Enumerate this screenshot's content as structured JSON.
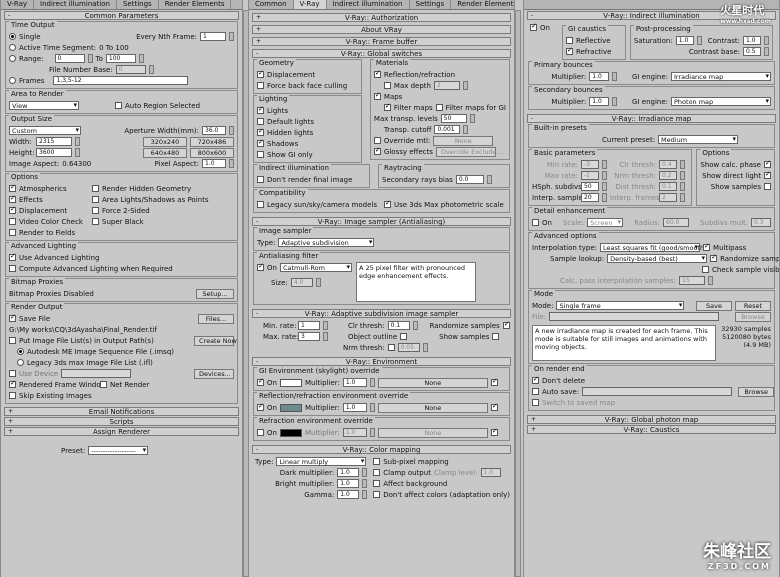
{
  "p1": {
    "tabs": [
      "V-Ray",
      "Indirect illumination",
      "Settings",
      "Render Elements"
    ],
    "common": "Common Parameters",
    "time": {
      "lg": "Time Output",
      "single": "Single",
      "nth": "Every Nth Frame:",
      "nth_v": "1",
      "active": "Active Time Segment:",
      "active_v": "0 To 100",
      "range": "Range:",
      "range_a": "0",
      "to": "To",
      "range_b": "100",
      "fnb": "File Number Base:",
      "fnb_v": "0",
      "frames": "Frames",
      "frames_v": "1,3,5-12"
    },
    "area": {
      "lg": "Area to Render",
      "view": "View",
      "auto": "Auto Region Selected"
    },
    "size": {
      "lg": "Output Size",
      "custom": "Custom",
      "aperture": "Aperture Width(mm):",
      "aperture_v": "36.0",
      "width": "Width:",
      "width_v": "2315",
      "height": "Height:",
      "height_v": "3600",
      "b1": "320x240",
      "b2": "720x486",
      "b3": "640x480",
      "b4": "800x600",
      "aspect": "Image Aspect:",
      "aspect_v": "0.64300",
      "pixel": "Pixel Aspect:",
      "pixel_v": "1.0"
    },
    "options": {
      "lg": "Options",
      "atmos": "Atmospherics",
      "hidden": "Render Hidden Geometry",
      "effects": "Effects",
      "area": "Area Lights/Shadows as Points",
      "displ": "Displacement",
      "force": "Force 2-Sided",
      "video": "Video Color Check",
      "super": "Super Black",
      "fields": "Render to Fields"
    },
    "adv": {
      "lg": "Advanced Lighting",
      "use": "Use Advanced Lighting",
      "compute": "Compute Advanced Lighting when Required"
    },
    "bitmap": {
      "lg": "Bitmap Proxies",
      "txt": "Bitmap Proxies Disabled",
      "setup": "Setup..."
    },
    "out": {
      "lg": "Render Output",
      "save": "Save File",
      "files": "Files...",
      "path": "G:\\My works\\CQ\\3dAyasha\\Final_Render.tif",
      "put": "Put Image File List(s) in Output Path(s)",
      "create": "Create Now",
      "autodesk": "Autodesk ME Image Sequence File (.imsq)",
      "legacy": "Legacy 3ds max Image File List (.ifl)",
      "device": "Use Device",
      "devices": "Devices...",
      "frame": "Rendered Frame Window",
      "net": "Net Render",
      "skip": "Skip Existing Images"
    },
    "email": "Email Notifications",
    "scripts": "Scripts",
    "assign": "Assign Renderer",
    "preset": "Preset:",
    "preset_v": "-------------------"
  },
  "p2": {
    "tabs": [
      "Common",
      "V-Ray",
      "Indirect illumination",
      "Settings",
      "Render Elements"
    ],
    "auth": "V-Ray:: Authorization",
    "about": "About VRay",
    "fb": "V-Ray:: Frame buffer",
    "gs": "V-Ray:: Global switches",
    "geom": {
      "lg": "Geometry",
      "displ": "Displacement",
      "force": "Force back face culling"
    },
    "mat": {
      "lg": "Materials",
      "refl": "Reflection/refraction",
      "maxd": "Max depth",
      "maxd_v": "2",
      "maps": "Maps",
      "filter": "Filter maps",
      "filtergi": "Filter maps for GI",
      "maxtr": "Max transp. levels",
      "maxtr_v": "50",
      "tcut": "Transp. cutoff",
      "tcut_v": "0.001",
      "ovr": "Override mtl:",
      "none": "None",
      "glossy": "Glossy effects",
      "ovrex": "Override Exclude..."
    },
    "light": {
      "lg": "Lighting",
      "lights": "Lights",
      "def": "Default lights",
      "hid": "Hidden lights",
      "sh": "Shadows",
      "gi": "Show GI only"
    },
    "ii": {
      "lg": "Indirect illumination",
      "dont": "Don't render final image"
    },
    "ray": {
      "lg": "Raytracing",
      "bias": "Secondary rays bias",
      "bias_v": "0.0"
    },
    "comp": {
      "lg": "Compatibility",
      "legacy": "Legacy sun/sky/camera models",
      "use3ds": "Use 3ds Max photometric scale"
    },
    "is": "V-Ray:: Image sampler (Antialiasing)",
    "samp": {
      "lg": "Image sampler",
      "type": "Type:",
      "type_v": "Adaptive subdivision"
    },
    "aa": {
      "lg": "Antialiasing filter",
      "on": "On",
      "filt": "Catmull-Rom",
      "desc": "A 25 pixel filter with pronounced edge enhancement effects.",
      "size": "Size:",
      "size_v": "4.0"
    },
    "asd": "V-Ray:: Adaptive subdivision image sampler",
    "adp": {
      "min": "Min. rate:",
      "min_v": "1",
      "max": "Max. rate:",
      "max_v": "3",
      "clr": "Clr thresh:",
      "clr_v": "0.1",
      "obj": "Object outline",
      "nrm": "Nrm thresh:",
      "nrm_v": "0.05",
      "rand": "Randomize samples",
      "show": "Show samples"
    },
    "env": "V-Ray:: Environment",
    "gienv": {
      "lg": "GI Environment (skylight) override",
      "on": "On",
      "mult": "Multiplier:",
      "mult_v": "1.0",
      "none": "None"
    },
    "rrenv": {
      "lg": "Reflection/refraction environment override",
      "on": "On",
      "mult": "Multiplier:",
      "mult_v": "1.0",
      "none": "None"
    },
    "rfenv": {
      "lg": "Refraction environment override",
      "on": "On",
      "mult": "Multiplier:",
      "mult_v": "1.0",
      "none": "None"
    },
    "cm": "V-Ray:: Color mapping",
    "col": {
      "type": "Type:",
      "type_v": "Linear multiply",
      "dark": "Dark multiplier:",
      "dark_v": "1.0",
      "bright": "Bright multiplier:",
      "bright_v": "1.0",
      "gamma": "Gamma:",
      "gamma_v": "1.0",
      "sub": "Sub-pixel mapping",
      "clamp": "Clamp output",
      "clampl": "Clamp level:",
      "clampl_v": "1.0",
      "affect": "Affect background",
      "dont": "Don't affect colors (adaptation only)"
    }
  },
  "p3": {
    "ii": "V-Ray:: Indirect illumination",
    "gi": {
      "on": "On",
      "caus": "GI caustics",
      "refl": "Reflective",
      "refr": "Refractive",
      "post": "Post-processing",
      "sat": "Saturation:",
      "sat_v": "1.0",
      "con": "Contrast:",
      "con_v": "1.0",
      "cb": "Contrast base:",
      "cb_v": "0.5"
    },
    "pb": {
      "lg": "Primary bounces",
      "mult": "Multiplier:",
      "mult_v": "1.0",
      "eng": "GI engine:",
      "eng_v": "Irradiance map"
    },
    "sb": {
      "lg": "Secondary bounces",
      "mult": "Multiplier:",
      "mult_v": "1.0",
      "eng": "GI engine:",
      "eng_v": "Photon map"
    },
    "im": "V-Ray:: Irradiance map",
    "pre": {
      "lg": "Built-in presets",
      "cur": "Current preset:",
      "cur_v": "Medium"
    },
    "basic": {
      "lg": "Basic parameters",
      "minr": "Min rate:",
      "minr_v": "-3",
      "maxr": "Max rate:",
      "maxr_v": "-1",
      "hsph": "HSph. subdivs:",
      "hsph_v": "50",
      "interp": "Interp. samples:",
      "interp_v": "20",
      "clr": "Clr thresh:",
      "clr_v": "0.4",
      "nrm": "Nrm thresh:",
      "nrm_v": "0.2",
      "dist": "Dist thresh:",
      "dist_v": "0.1",
      "frames": "Interp. frames:",
      "frames_v": "2"
    },
    "opt": {
      "lg": "Options",
      "calc": "Show calc. phase",
      "direct": "Show direct light",
      "samples": "Show samples"
    },
    "det": {
      "lg": "Detail enhancement",
      "on": "On",
      "scale": "Scale:",
      "scale_v": "Screen",
      "radius": "Radius:",
      "radius_v": "60.0",
      "subd": "Subdivs mult.",
      "subd_v": "0.3"
    },
    "adv": {
      "lg": "Advanced options",
      "itype": "Interpolation type:",
      "itype_v": "Least squares fit (good/smooth",
      "multi": "Multipass",
      "look": "Sample lookup:",
      "look_v": "Density-based (best)",
      "rand": "Randomize samples",
      "check": "Check sample visibility",
      "calc": "Calc. pass interpolation samples:",
      "calc_v": "15"
    },
    "mode": {
      "lg": "Mode",
      "mode": "Mode:",
      "mode_v": "Single frame",
      "save": "Save",
      "reset": "Reset",
      "file": "File:",
      "browse": "Browse",
      "desc": "A new irradiance map is created for each frame. This mode is suitable for still images and animations with moving objects.",
      "samples": "32930 samples",
      "bytes": "5120080 bytes (4.9 MB)"
    },
    "end": {
      "lg": "On render end",
      "dont": "Don't delete",
      "auto": "Auto save:",
      "browse": "Browse",
      "switch": "Switch to saved map"
    },
    "gpm": "V-Ray:: Global photon map",
    "caus": "V-Ray:: Caustics"
  },
  "wm": {
    "top": "火星时代",
    "top_url": "www.hxsd.com",
    "bottom": "朱峰社区",
    "bottom_url": "ZF3D.COM"
  }
}
